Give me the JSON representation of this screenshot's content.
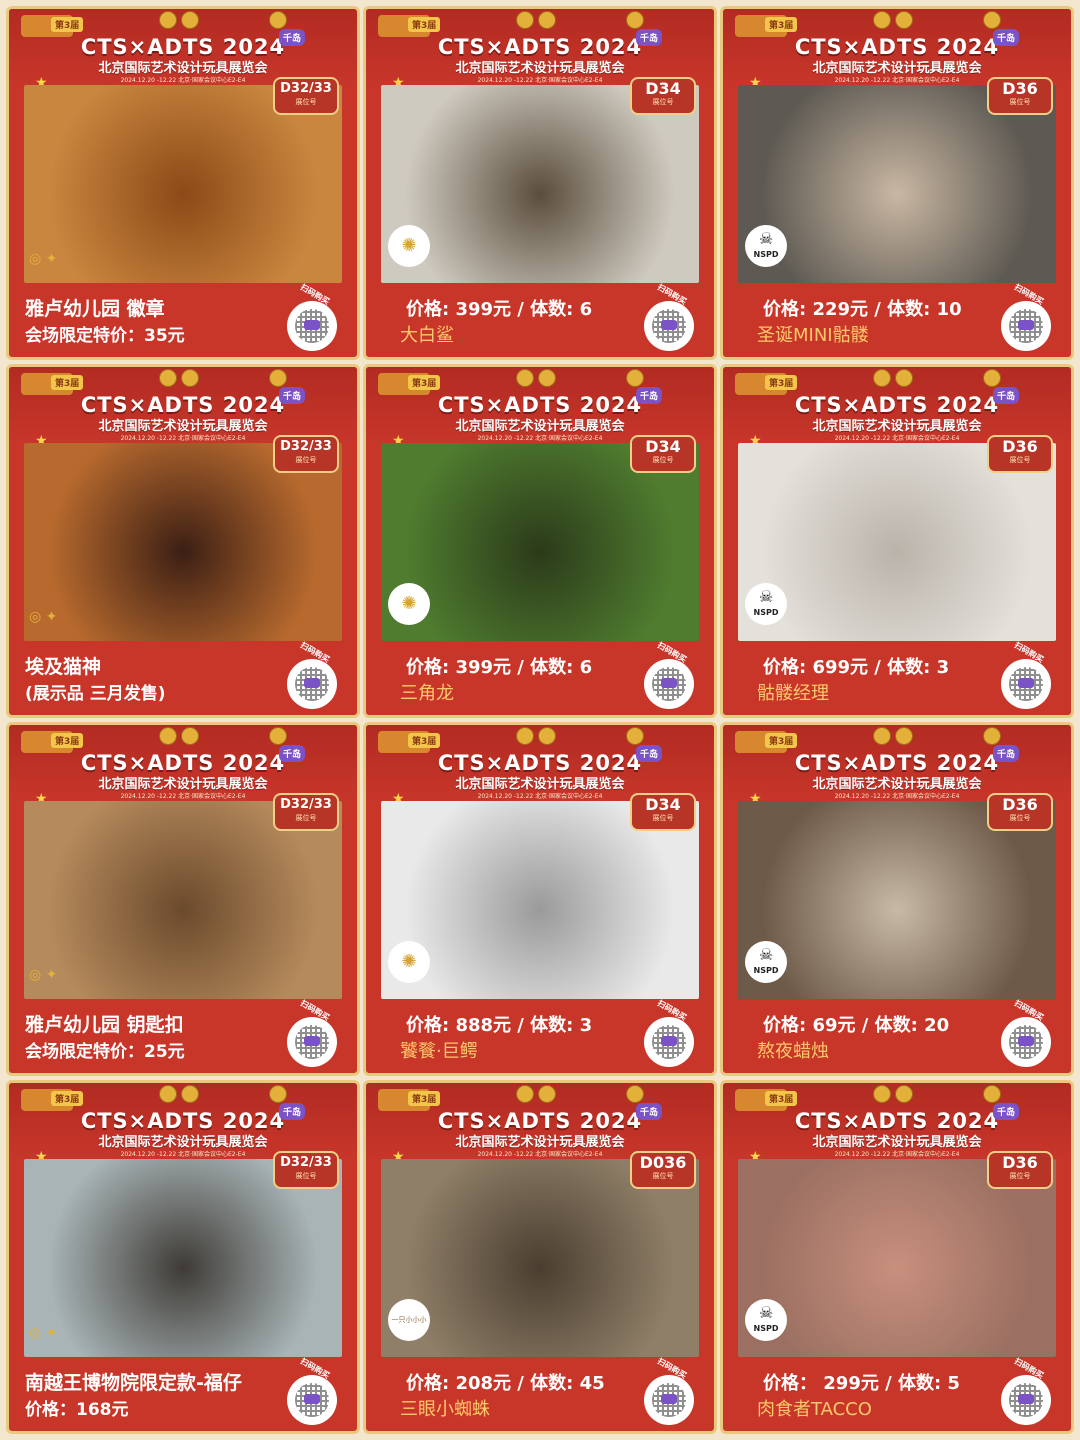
{
  "exhibition": {
    "title": "CTS×ADTS 2024",
    "subtitle": "北京国际艺术设计玩具展览会",
    "dates": "2024.12.20 -12.22      北京·国家会议中心E2-E4",
    "tag": "第3届",
    "badge": "千岛",
    "booth_label": "展位号",
    "scan_label": "扫码购买"
  },
  "cards": [
    {
      "booth": "D32/33",
      "style": "info",
      "line1": "雅卢幼儿园 徽章",
      "line2": "会场限定特价：35元",
      "logo": "pair",
      "photo_colors": [
        "#c9863f",
        "#8b4a17"
      ]
    },
    {
      "booth": "D34",
      "style": "price",
      "price": "价格: 399元  /  体数: 6",
      "name": "大白鲨",
      "logo": "sun",
      "photo_colors": [
        "#cfcac0",
        "#5a4d3c"
      ]
    },
    {
      "booth": "D36",
      "style": "price",
      "price": "价格: 229元  /  体数: 10",
      "name": "圣诞MINI骷髅",
      "logo": "nspd",
      "photo_colors": [
        "#5e5a53",
        "#c9b7a2"
      ]
    },
    {
      "booth": "D32/33",
      "style": "info",
      "line1": "埃及猫神",
      "line2": "(展示品 三月发售)",
      "logo": "pair",
      "photo_colors": [
        "#b86a2e",
        "#3c1f14"
      ]
    },
    {
      "booth": "D34",
      "style": "price",
      "price": "价格: 399元  /  体数: 6",
      "name": "三角龙",
      "logo": "sun",
      "photo_colors": [
        "#4f7c2f",
        "#2b3a1a"
      ]
    },
    {
      "booth": "D36",
      "style": "price",
      "price": "价格: 699元  /  体数: 3",
      "name": "骷髅经理",
      "logo": "nspd",
      "photo_colors": [
        "#e4e0da",
        "#b9b3aa"
      ]
    },
    {
      "booth": "D32/33",
      "style": "info",
      "line1": "雅卢幼儿园 钥匙扣",
      "line2": "会场限定特价：25元",
      "logo": "pair",
      "photo_colors": [
        "#b58a5c",
        "#6b4a2c"
      ]
    },
    {
      "booth": "D34",
      "style": "price",
      "price": "价格: 888元  /  体数: 3",
      "name": "饕餮·巨鳄",
      "logo": "sun",
      "photo_colors": [
        "#e9e9e9",
        "#9a9a9a"
      ]
    },
    {
      "booth": "D36",
      "style": "price",
      "price": "价格: 69元  /  体数: 20",
      "name": "熬夜蜡烛",
      "logo": "nspd",
      "photo_colors": [
        "#6e5a48",
        "#c8b9a7"
      ]
    },
    {
      "booth": "D32/33",
      "style": "info",
      "line1": "南越王博物院限定款-福仔",
      "line2": "价格：168元",
      "logo": "pair",
      "photo_colors": [
        "#a8b4b6",
        "#3f3b36"
      ]
    },
    {
      "booth": "D036",
      "style": "price",
      "price": "价格: 208元  /  体数: 45",
      "name": "三眼小蜘蛛",
      "logo": "brand",
      "photo_colors": [
        "#8f7f68",
        "#4a3e30"
      ]
    },
    {
      "booth": "D36",
      "style": "price",
      "price": "价格： 299元  /  体数: 5",
      "name": "肉食者TACCO",
      "logo": "nspd",
      "photo_colors": [
        "#9b7062",
        "#c88f7d"
      ]
    }
  ],
  "logos": {
    "nspd": "NSPD",
    "sun": "✺",
    "pair": "◎ ✦",
    "brand": "一只小小小"
  }
}
